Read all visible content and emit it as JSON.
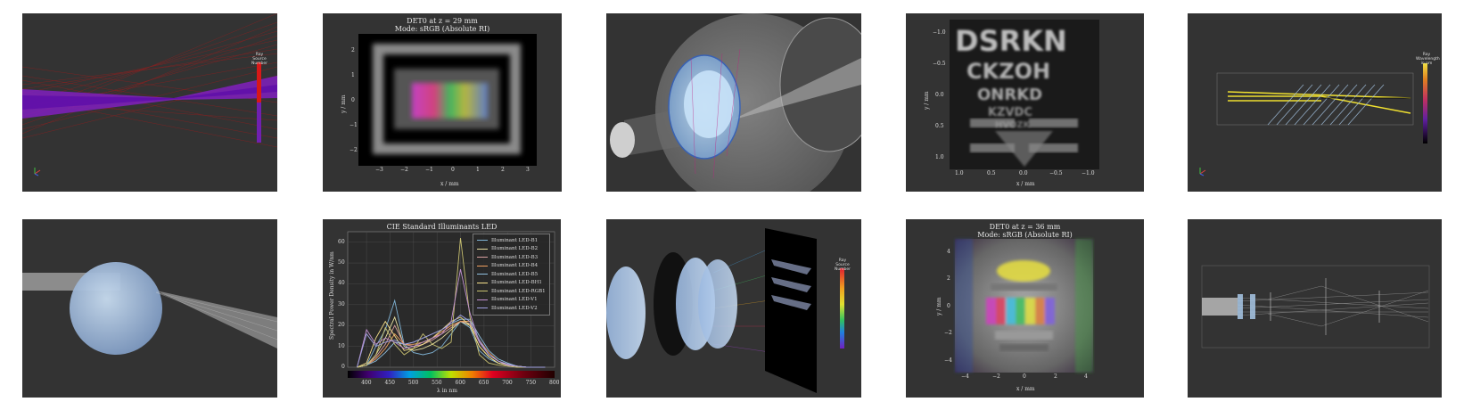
{
  "tiles": {
    "t1": {
      "colorbar_label": "Ray Source Number"
    },
    "t2": {
      "title": "DET0 at z = 29 mm",
      "subtitle": "Mode: sRGB (Absolute RI)",
      "xlabel": "x / mm",
      "ylabel": "y / mm",
      "xticks": [
        "−3",
        "−2",
        "−1",
        "0",
        "1",
        "2",
        "3"
      ],
      "yticks": [
        "2",
        "1",
        "0",
        "−1",
        "−2"
      ]
    },
    "t4": {
      "xlabel": "x / mm",
      "ylabel": "y / mm",
      "xticks": [
        "1.0",
        "0.5",
        "0.0",
        "−0.5",
        "−1.0"
      ],
      "yticks": [
        "−1.0",
        "−0.5",
        "0.0",
        "0.5",
        "1.0"
      ],
      "chart_letters": "DSRKN CKZOH ONRKD"
    },
    "t5": {
      "colorbar_label": "Ray Wavelength in nm"
    },
    "t7": {
      "chart_data": {
        "type": "line",
        "title": "CIE Standard Illuminants LED",
        "xlabel": "λ in nm",
        "ylabel": "Spectral Power Density in W/nm",
        "xlim": [
          360,
          800
        ],
        "ylim": [
          0,
          65
        ],
        "xticks": [
          "400",
          "450",
          "500",
          "550",
          "600",
          "650",
          "700",
          "750",
          "800"
        ],
        "yticks": [
          "0",
          "10",
          "20",
          "30",
          "40",
          "50",
          "60"
        ],
        "legend_position": "top-right",
        "grid": true,
        "x": [
          380,
          400,
          420,
          440,
          460,
          480,
          500,
          520,
          540,
          560,
          580,
          600,
          620,
          640,
          660,
          680,
          700,
          720,
          740,
          760,
          780
        ],
        "series": [
          {
            "name": "Illuminant LED-B1",
            "color": "#7fb3d5",
            "values": [
              0,
              1,
              10,
              18,
              32,
              11,
              7,
              6,
              7,
              10,
              16,
              22,
              19,
              8,
              4,
              2,
              1,
              0.5,
              0,
              0,
              0
            ]
          },
          {
            "name": "Illuminant LED-B2",
            "color": "#e8e0a0",
            "values": [
              0,
              1,
              6,
              14,
              24,
              10,
              8,
              9,
              11,
              14,
              18,
              22,
              20,
              10,
              5,
              2,
              1,
              0.5,
              0,
              0,
              0
            ]
          },
          {
            "name": "Illuminant LED-B3",
            "color": "#d9a0a0",
            "values": [
              0,
              1,
              5,
              11,
              20,
              11,
              10,
              11,
              13,
              16,
              19,
              22,
              21,
              12,
              6,
              3,
              1,
              0.5,
              0,
              0,
              0
            ]
          },
          {
            "name": "Illuminant LED-B4",
            "color": "#f0a060",
            "values": [
              0,
              1,
              4,
              9,
              16,
              11,
              11,
              12,
              14,
              17,
              20,
              22,
              22,
              13,
              7,
              3,
              1.5,
              0.5,
              0,
              0,
              0
            ]
          },
          {
            "name": "Illuminant LED-B5",
            "color": "#90c0e0",
            "values": [
              0,
              1,
              3,
              7,
              12,
              11,
              12,
              14,
              16,
              18,
              21,
              23,
              23,
              15,
              8,
              4,
              2,
              0.5,
              0,
              0,
              0
            ]
          },
          {
            "name": "Illuminant LED-BH1",
            "color": "#f5e08a",
            "values": [
              0,
              2,
              14,
              22,
              15,
              8,
              9,
              11,
              14,
              18,
              22,
              24,
              20,
              10,
              5,
              2,
              1,
              0.5,
              0,
              0,
              0
            ]
          },
          {
            "name": "Illuminant LED-RGB1",
            "color": "#c8c070",
            "values": [
              0,
              1,
              6,
              19,
              11,
              6,
              9,
              16,
              11,
              9,
              12,
              62,
              24,
              6,
              2,
              1,
              0.5,
              0,
              0,
              0,
              0
            ]
          },
          {
            "name": "Illuminant LED-V1",
            "color": "#c090d0",
            "values": [
              0,
              18,
              11,
              14,
              12,
              9,
              10,
              12,
              14,
              16,
              22,
              47,
              26,
              12,
              6,
              3,
              1,
              0.5,
              0,
              0,
              0
            ]
          },
          {
            "name": "Illuminant LED-V2",
            "color": "#a0a0e0",
            "values": [
              0,
              16,
              10,
              12,
              13,
              11,
              12,
              14,
              16,
              18,
              21,
              25,
              22,
              13,
              6,
              3,
              1.5,
              0.5,
              0,
              0,
              0
            ]
          }
        ]
      }
    },
    "t8": {
      "colorbar_label": "Ray Source Number"
    },
    "t9": {
      "title": "DET0 at z = 36 mm",
      "subtitle": "Mode: sRGB (Absolute RI)",
      "xlabel": "x / mm",
      "ylabel": "y / mm",
      "xticks": [
        "−4",
        "−2",
        "0",
        "2",
        "4"
      ],
      "yticks": [
        "4",
        "2",
        "0",
        "−2",
        "−4"
      ]
    }
  }
}
